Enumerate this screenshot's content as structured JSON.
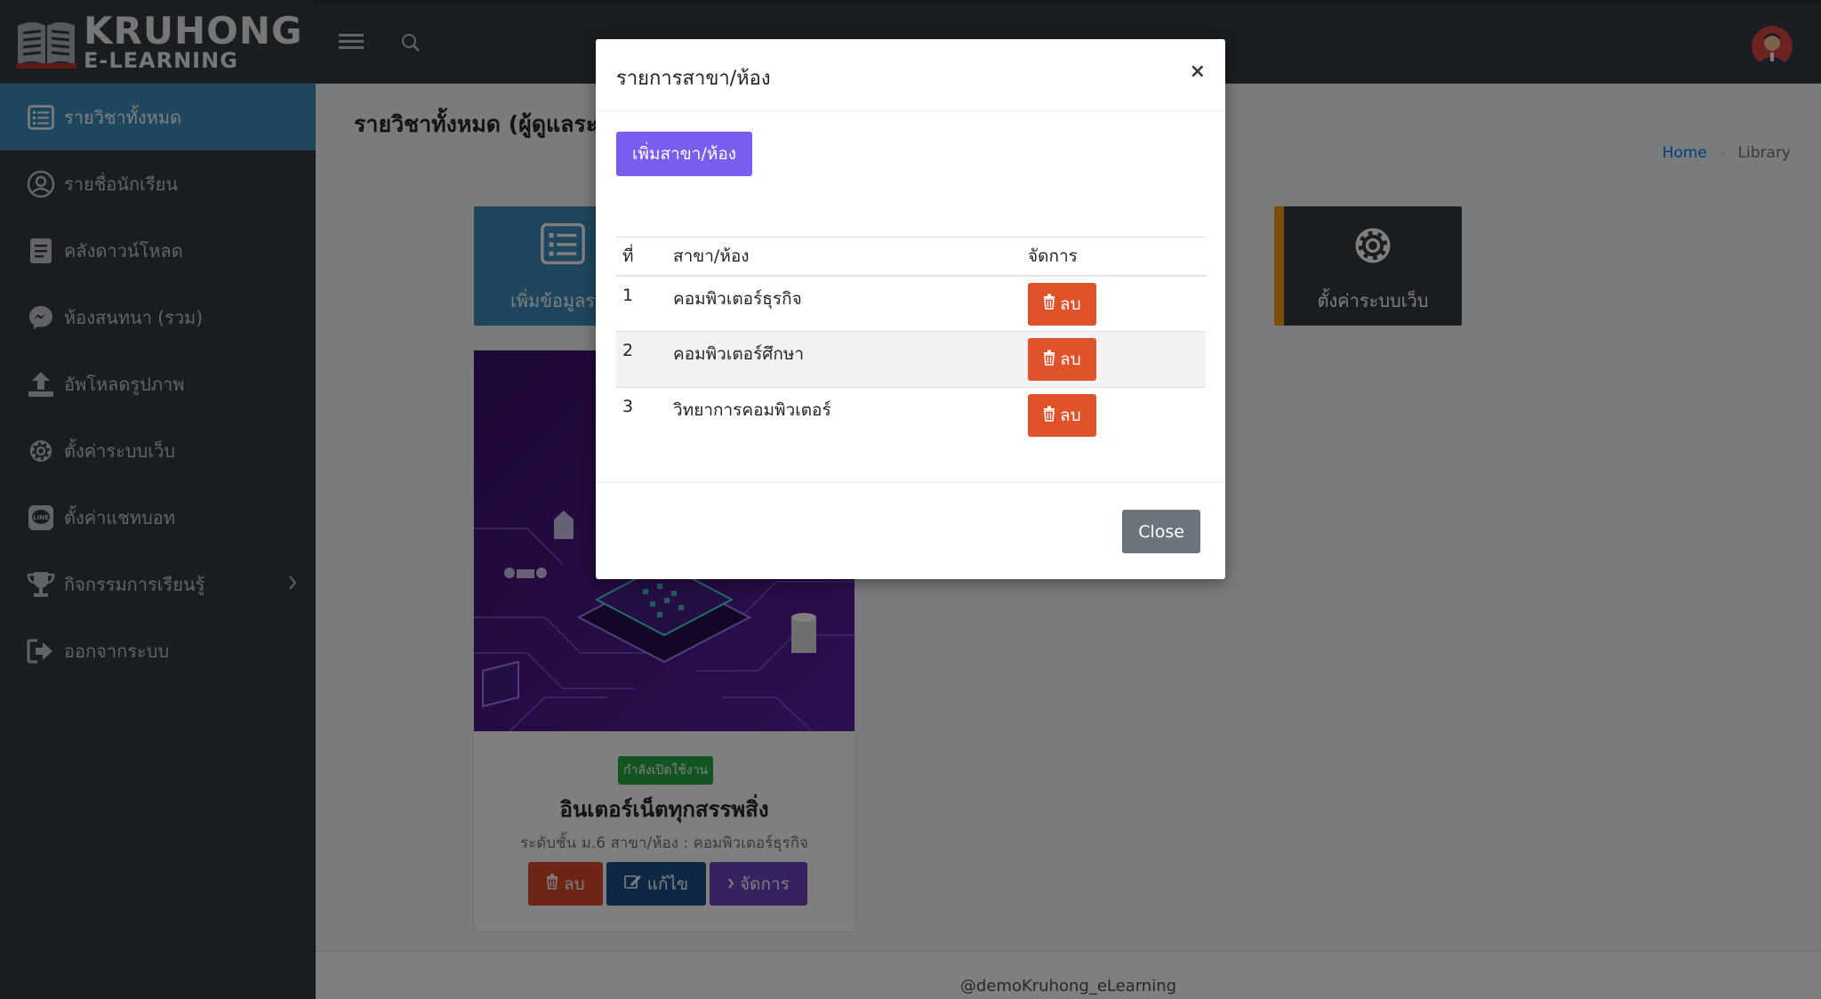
{
  "brand": {
    "title": "KRUHONG",
    "subtitle": "E-LEARNING"
  },
  "sidebar": {
    "items": [
      {
        "label": "รายวิชาทั้งหมด",
        "icon": "list-icon",
        "active": true
      },
      {
        "label": "รายชื่อนักเรียน",
        "icon": "user-circle-icon"
      },
      {
        "label": "คลังดาวน์โหลด",
        "icon": "book-icon"
      },
      {
        "label": "ห้องสนทนา (รวม)",
        "icon": "messenger-icon"
      },
      {
        "label": "อัพโหลดรูปภาพ",
        "icon": "upload-icon"
      },
      {
        "label": "ตั้งค่าระบบเว็บ",
        "icon": "gear-icon"
      },
      {
        "label": "ตั้งค่าแชทบอท",
        "icon": "line-icon"
      },
      {
        "label": "กิจกรรมการเรียนรู้",
        "icon": "trophy-icon",
        "has_submenu": true
      },
      {
        "label": "ออกจากระบบ",
        "icon": "sign-out-icon"
      }
    ]
  },
  "page": {
    "title": "รายวิชาทั้งหมด (ผู้ดูแลระบ",
    "breadcrumb": {
      "home": "Home",
      "current": "Library"
    },
    "cards": [
      {
        "label": "เพิ่มข้อมูลราย",
        "color": "#3c8dbc"
      },
      {
        "label": "",
        "color": "#f39c12"
      },
      {
        "label": "ตั้งค่าระบบเว็บ",
        "color": "#343a40"
      }
    ],
    "course": {
      "status": "กำลังเปิดใช้งาน",
      "title": "อินเตอร์เน็ตทุกสรรพสิ่ง",
      "subtitle": "ระดับชั้น ม.6 สาขา/ห้อง : คอมพิวเตอร์ธุรกิจ",
      "buttons": {
        "delete": "ลบ",
        "edit": "แก้ไข",
        "manage": "จัดการ"
      }
    }
  },
  "footer": {
    "text": "@demoKruhong_eLearning"
  },
  "modal": {
    "title": "รายการสาขา/ห้อง",
    "close_x": "×",
    "add_button": "เพิ่มสาขา/ห้อง",
    "table": {
      "headers": [
        "ที่",
        "สาขา/ห้อง",
        "จัดการ"
      ],
      "rows": [
        {
          "no": "1",
          "name": "คอมพิวเตอร์ธุรกิจ",
          "action": "ลบ"
        },
        {
          "no": "2",
          "name": "คอมพิวเตอร์ศึกษา",
          "action": "ลบ"
        },
        {
          "no": "3",
          "name": "วิทยาการคอมพิวเตอร์",
          "action": "ลบ"
        }
      ]
    },
    "close_button": "Close"
  },
  "colors": {
    "sidebar": "#343a40",
    "active": "#3c8dbc",
    "add_button": "#7a5cf0",
    "delete": "#e0532a",
    "edit": "#1d4e89",
    "manage": "#6f42c1",
    "close": "#6c757d"
  }
}
